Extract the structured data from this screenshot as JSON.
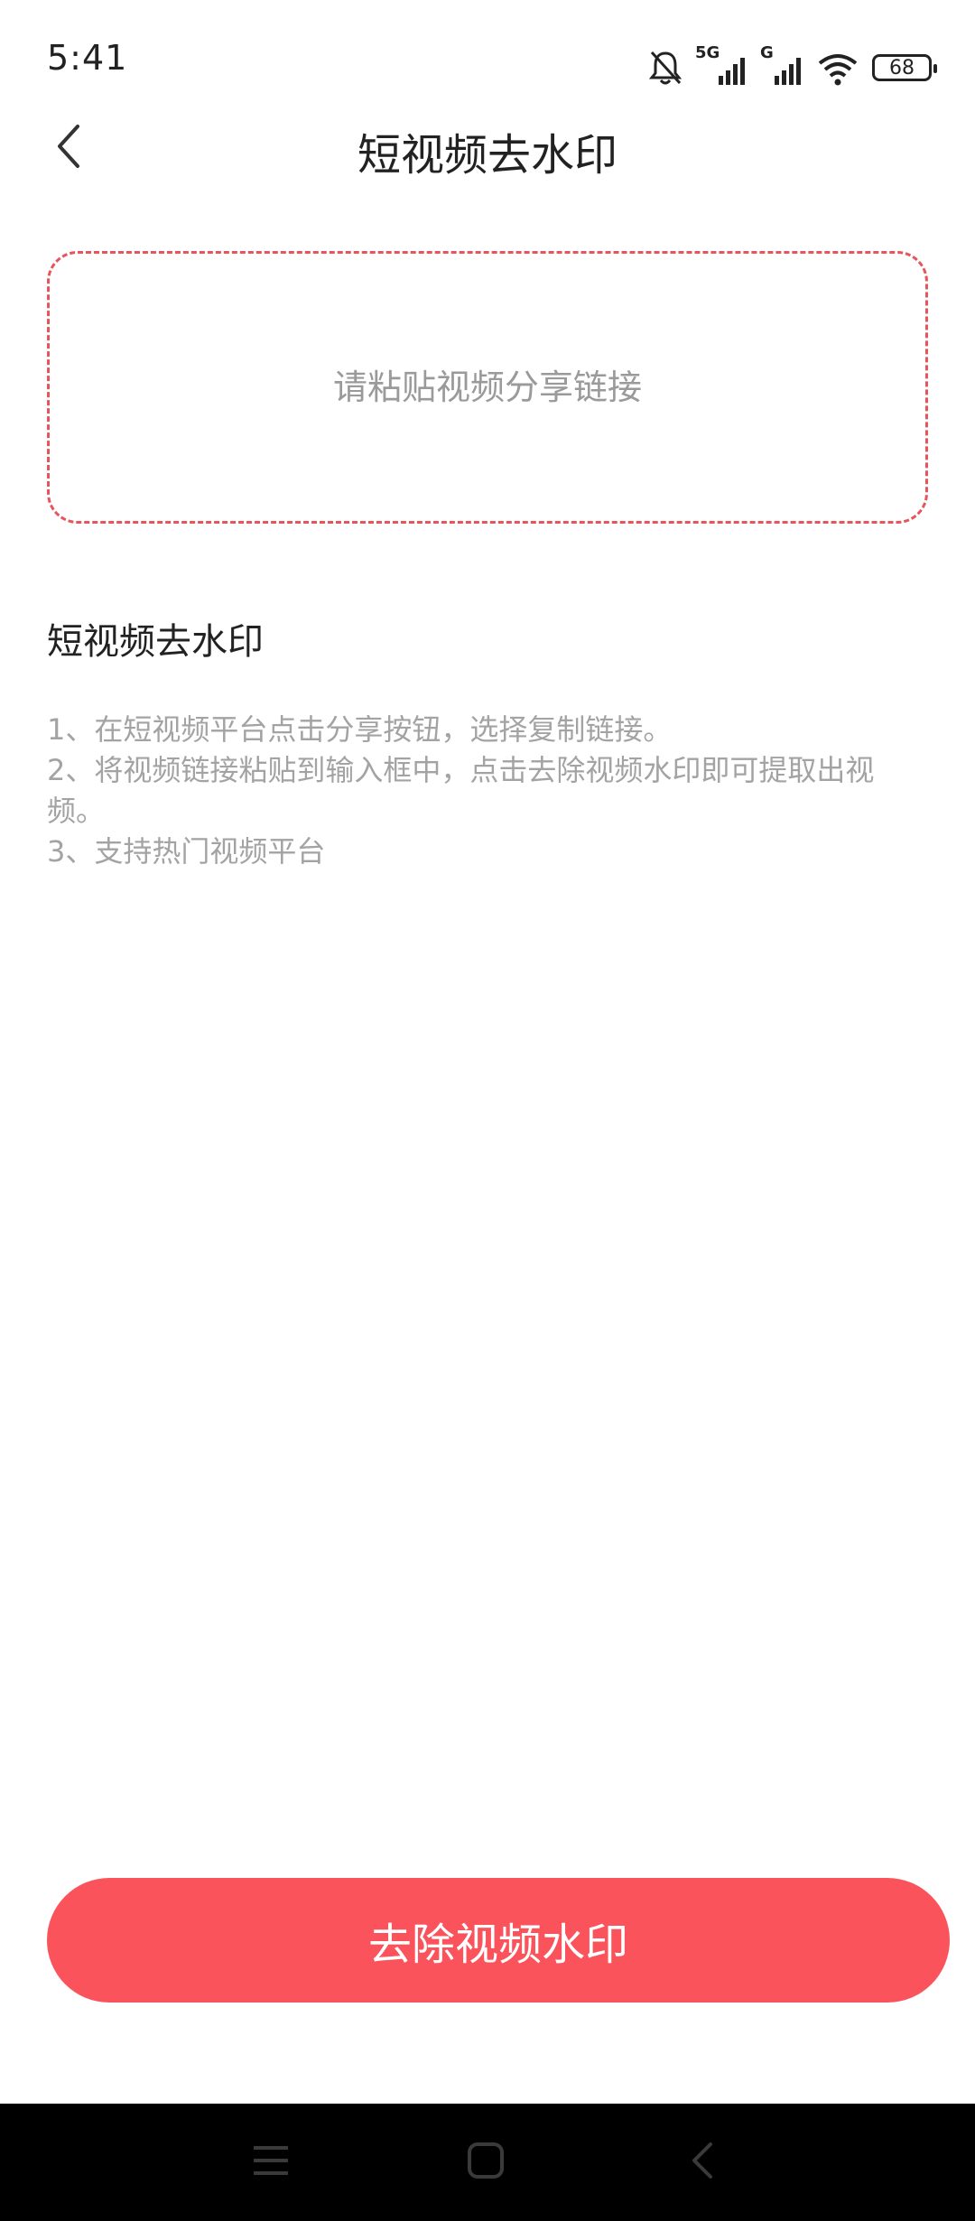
{
  "status_bar": {
    "time": "5:41",
    "network_5g": "5G",
    "network_g": "G",
    "battery": "68",
    "icons": [
      "bell-muted-icon",
      "signal-5g-icon",
      "signal-g-icon",
      "wifi-icon",
      "battery-icon"
    ]
  },
  "header": {
    "title": "短视频去水印",
    "back_icon": "chevron-left-icon"
  },
  "input": {
    "placeholder": "请粘贴视频分享链接",
    "value": ""
  },
  "instructions": {
    "title": "短视频去水印",
    "steps": [
      "1、在短视频平台点击分享按钮，选择复制链接。",
      "2、将视频链接粘贴到输入框中，点击去除视频水印即可提取出视频。",
      "3、支持热门视频平台"
    ]
  },
  "action": {
    "label": "去除视频水印"
  },
  "nav_bar": {
    "icons": [
      "menu-icon",
      "home-icon",
      "back-icon"
    ]
  },
  "colors": {
    "accent": "#fb535c",
    "dashed_border": "#e7545c",
    "hint_text": "#a3a3a3"
  }
}
